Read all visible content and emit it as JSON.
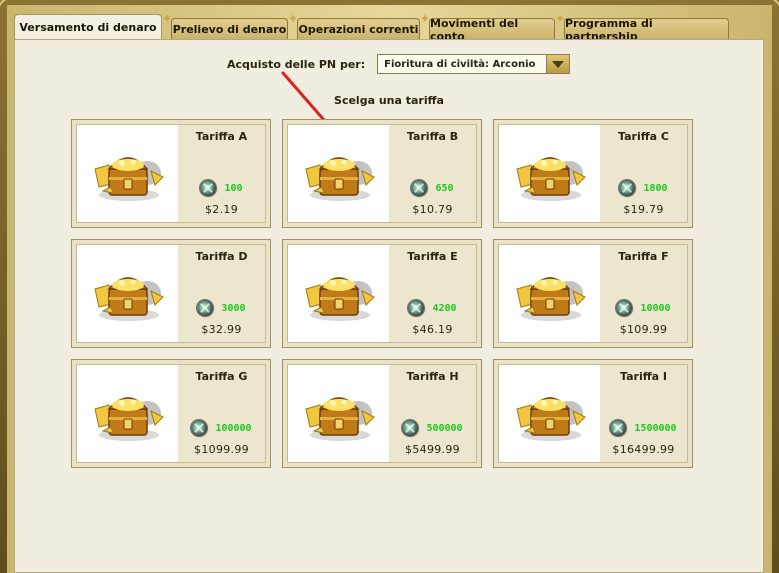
{
  "tabs": [
    {
      "label": "Versamento di denaro",
      "active": true
    },
    {
      "label": "Prelievo di denaro",
      "active": false
    },
    {
      "label": "Operazioni correnti",
      "active": false
    },
    {
      "label": "Movimenti del conto",
      "active": false
    },
    {
      "label": "Programma di partnership",
      "active": false
    }
  ],
  "purchase": {
    "label": "Acquisto delle PN per:",
    "selected": "Fioritura di civiltà: Arconio"
  },
  "subtitle": "Scelga una tariffa",
  "tariffs": [
    {
      "name": "Tariffa A",
      "amount": "100",
      "price": "$2.19"
    },
    {
      "name": "Tariffa B",
      "amount": "650",
      "price": "$10.79"
    },
    {
      "name": "Tariffa C",
      "amount": "1800",
      "price": "$19.79"
    },
    {
      "name": "Tariffa D",
      "amount": "3000",
      "price": "$32.99"
    },
    {
      "name": "Tariffa E",
      "amount": "4200",
      "price": "$46.19"
    },
    {
      "name": "Tariffa F",
      "amount": "10000",
      "price": "$109.99"
    },
    {
      "name": "Tariffa G",
      "amount": "100000",
      "price": "$1099.99"
    },
    {
      "name": "Tariffa H",
      "amount": "500000",
      "price": "$5499.99"
    },
    {
      "name": "Tariffa I",
      "amount": "1500000",
      "price": "$16499.99"
    }
  ],
  "colors": {
    "amount": "#1dc81d",
    "arrow": "#e02020",
    "panel": "#f1ede0"
  },
  "icons": {
    "card_image": "treasure-chest-icon",
    "currency": "gem-icon",
    "dropdown": "chevron-down-icon"
  }
}
